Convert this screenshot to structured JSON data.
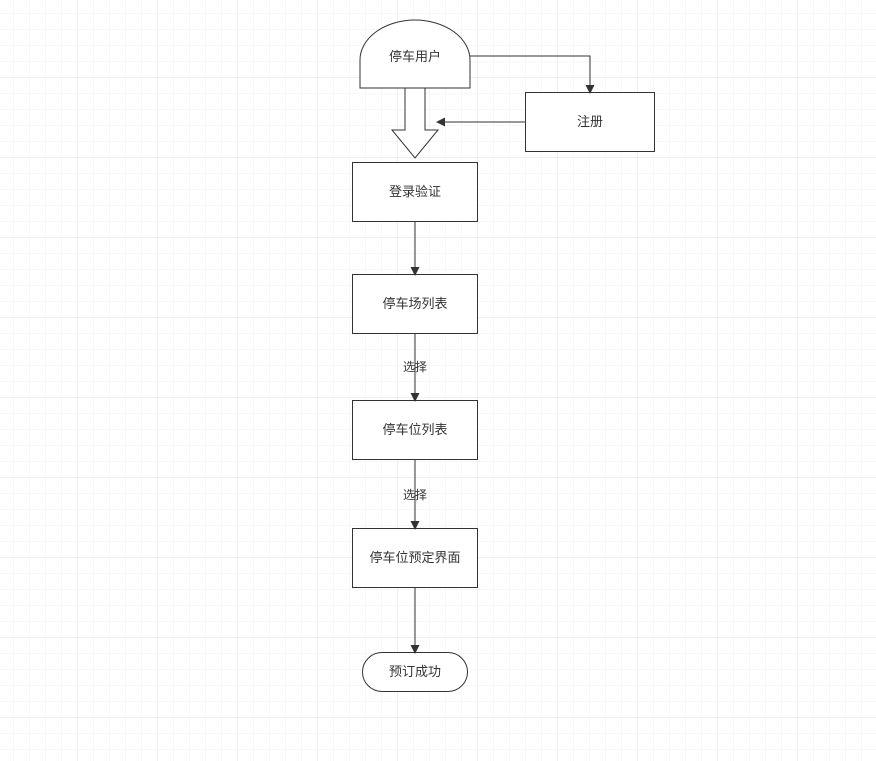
{
  "nodes": {
    "start": {
      "label": "停车用户"
    },
    "register": {
      "label": "注册"
    },
    "login": {
      "label": "登录验证"
    },
    "lotlist": {
      "label": "停车场列表"
    },
    "spotlist": {
      "label": "停车位列表"
    },
    "booking": {
      "label": "停车位预定界面"
    },
    "success": {
      "label": "预订成功"
    }
  },
  "edges": {
    "select1": {
      "label": "选择"
    },
    "select2": {
      "label": "选择"
    }
  }
}
